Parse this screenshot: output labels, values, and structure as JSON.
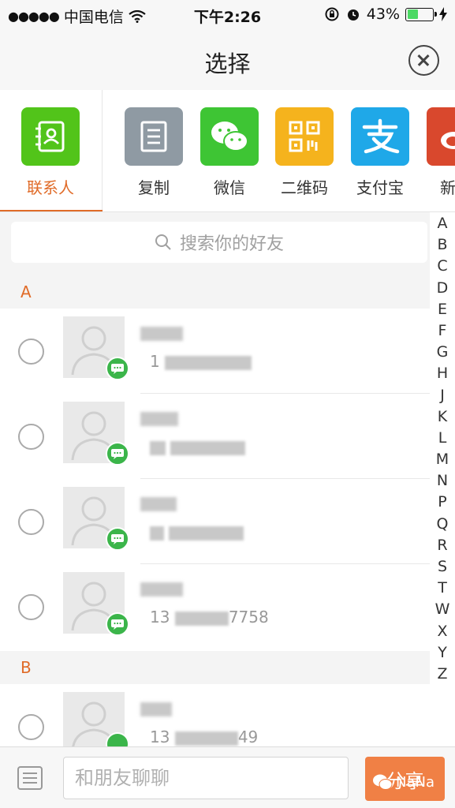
{
  "status_bar": {
    "carrier": "中国电信",
    "time": "下午2:26",
    "battery": "43%"
  },
  "nav": {
    "title": "选择"
  },
  "share_targets": [
    {
      "label": "联系人",
      "color": "#52c41a",
      "icon": "contacts-icon",
      "active": true
    },
    {
      "label": "复制",
      "color": "#8f9aa3",
      "icon": "copy-icon"
    },
    {
      "label": "微信",
      "color": "#3ec534",
      "icon": "wechat-icon"
    },
    {
      "label": "二维码",
      "color": "#f5b31d",
      "icon": "qrcode-icon"
    },
    {
      "label": "支付宝",
      "color": "#1fa8e8",
      "icon": "alipay-icon"
    },
    {
      "label": "新浪",
      "color": "#d9482d",
      "icon": "weibo-icon"
    }
  ],
  "search": {
    "placeholder": "搜索你的好友"
  },
  "sections": [
    {
      "letter": "A"
    },
    {
      "letter": "B"
    }
  ],
  "contacts": [
    {
      "phone_prefix": "1"
    },
    {
      "phone_prefix": ""
    },
    {
      "phone_prefix": ""
    },
    {
      "phone_prefix": "13",
      "phone_suffix": "7758"
    },
    {
      "phone_prefix": "13",
      "phone_suffix": "49"
    }
  ],
  "alpha_index": [
    "A",
    "B",
    "C",
    "D",
    "E",
    "F",
    "G",
    "H",
    "J",
    "K",
    "L",
    "M",
    "N",
    "P",
    "Q",
    "R",
    "S",
    "T",
    "W",
    "X",
    "Y",
    "Z"
  ],
  "bottom_bar": {
    "input_placeholder": "和朋友聊聊",
    "send_label": "分享",
    "watermark": "NaNa"
  },
  "colors": {
    "accent": "#e06b28",
    "badge_green": "#3bb54a"
  }
}
